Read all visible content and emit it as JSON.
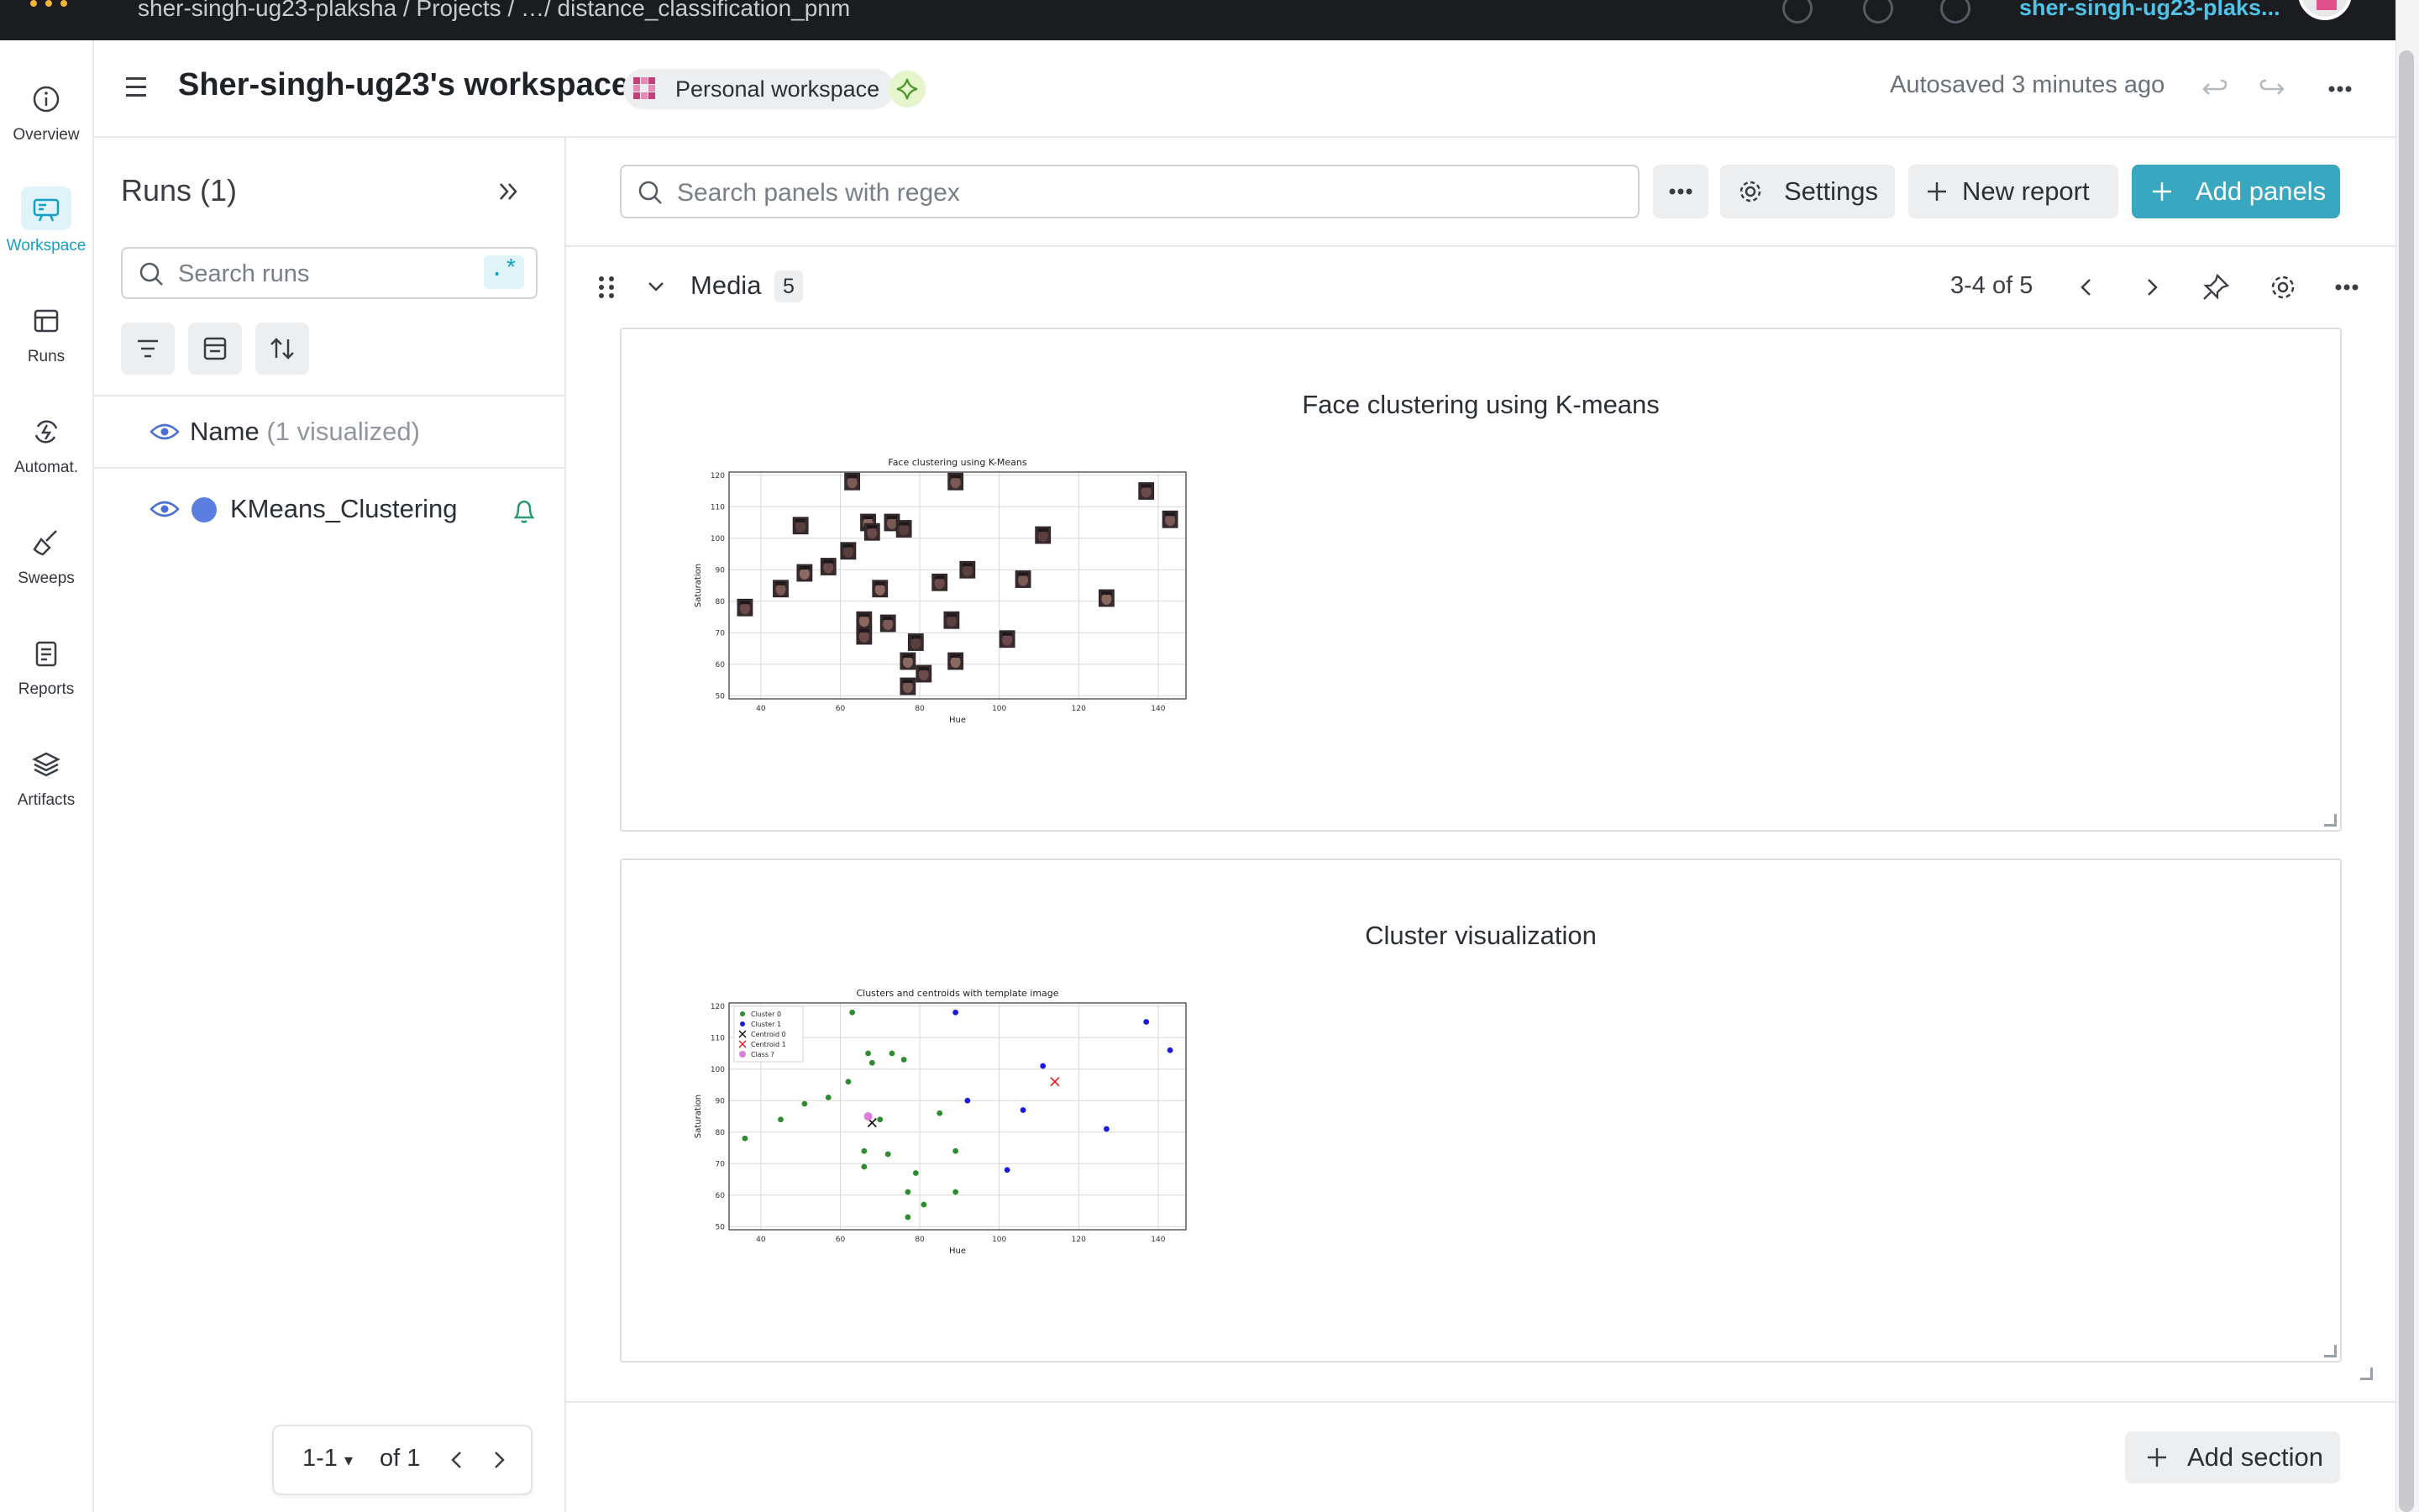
{
  "topbar": {
    "breadcrumb": "sher-singh-ug23-plaksha  /  Projects  /  …/ distance_classification_pnm",
    "username": "sher-singh-ug23-plaks..."
  },
  "nav": {
    "items": [
      {
        "label": "Overview",
        "icon": "info-icon"
      },
      {
        "label": "Workspace",
        "icon": "workspace-icon"
      },
      {
        "label": "Runs",
        "icon": "runs-table-icon"
      },
      {
        "label": "Automat.",
        "icon": "automation-icon"
      },
      {
        "label": "Sweeps",
        "icon": "broom-icon"
      },
      {
        "label": "Reports",
        "icon": "report-icon"
      },
      {
        "label": "Artifacts",
        "icon": "layers-icon"
      }
    ],
    "active": "Workspace",
    "accent": "#13a0c7"
  },
  "header": {
    "title": "Sher-singh-ug23's workspace",
    "badge": "Personal workspace",
    "autosaved": "Autosaved 3 minutes ago"
  },
  "runs": {
    "title": "Runs (1)",
    "search_placeholder": "Search runs",
    "regex_label": ".*",
    "name_header": "Name",
    "name_header_note": "(1 visualized)",
    "rows": [
      {
        "name": "KMeans_Clustering",
        "color": "#5b7fe0"
      }
    ],
    "pager": {
      "range": "1-1",
      "of": "of 1"
    }
  },
  "toolbar": {
    "search_placeholder": "Search panels with regex",
    "settings_label": "Settings",
    "new_report_label": "New report",
    "add_panels_label": "Add panels",
    "add_panels_color": "#3aa7c1"
  },
  "section": {
    "title": "Media",
    "count": "5",
    "pager": "3-4 of 5",
    "add_section_label": "Add section"
  },
  "panels": [
    {
      "title": "Face clustering using K-means",
      "plot_title": "Face clustering using K-Means",
      "xlabel": "Hue",
      "ylabel": "Saturation"
    },
    {
      "title": "Cluster visualization",
      "plot_title": "Clusters and centroids with template image",
      "xlabel": "Hue",
      "ylabel": "Saturation",
      "legend": [
        "Cluster 0",
        "Cluster 1",
        "Centroid 0",
        "Centroid 1",
        "Class ?"
      ]
    }
  ],
  "chart_data": [
    {
      "type": "scatter",
      "title": "Face clustering using K-Means",
      "xlabel": "Hue",
      "ylabel": "Saturation",
      "xlim": [
        32,
        147
      ],
      "ylim": [
        49,
        121
      ],
      "xticks": [
        40,
        60,
        80,
        100,
        120,
        140
      ],
      "yticks": [
        50,
        60,
        70,
        80,
        90,
        100,
        110,
        120
      ],
      "grid": true,
      "marker": "face-thumbnail",
      "points": [
        {
          "x": 36,
          "y": 78
        },
        {
          "x": 45,
          "y": 84
        },
        {
          "x": 50,
          "y": 104
        },
        {
          "x": 51,
          "y": 89
        },
        {
          "x": 57,
          "y": 91
        },
        {
          "x": 63,
          "y": 118
        },
        {
          "x": 62,
          "y": 96
        },
        {
          "x": 67,
          "y": 105
        },
        {
          "x": 68,
          "y": 102
        },
        {
          "x": 73,
          "y": 105
        },
        {
          "x": 76,
          "y": 103
        },
        {
          "x": 70,
          "y": 84
        },
        {
          "x": 85,
          "y": 86
        },
        {
          "x": 89,
          "y": 118
        },
        {
          "x": 92,
          "y": 90
        },
        {
          "x": 66,
          "y": 74
        },
        {
          "x": 66,
          "y": 69
        },
        {
          "x": 72,
          "y": 73
        },
        {
          "x": 79,
          "y": 67
        },
        {
          "x": 77,
          "y": 61
        },
        {
          "x": 81,
          "y": 57
        },
        {
          "x": 77,
          "y": 53
        },
        {
          "x": 88,
          "y": 74
        },
        {
          "x": 89,
          "y": 61
        },
        {
          "x": 102,
          "y": 68
        },
        {
          "x": 106,
          "y": 87
        },
        {
          "x": 111,
          "y": 101
        },
        {
          "x": 127,
          "y": 81
        },
        {
          "x": 137,
          "y": 115
        },
        {
          "x": 143,
          "y": 106
        }
      ]
    },
    {
      "type": "scatter",
      "title": "Clusters and centroids with template image",
      "xlabel": "Hue",
      "ylabel": "Saturation",
      "xlim": [
        32,
        147
      ],
      "ylim": [
        49,
        121
      ],
      "xticks": [
        40,
        60,
        80,
        100,
        120,
        140
      ],
      "yticks": [
        50,
        60,
        70,
        80,
        90,
        100,
        110,
        120
      ],
      "grid": true,
      "legend": "top-left",
      "series": [
        {
          "name": "Cluster 0",
          "color": "#2e8b2e",
          "marker": "dot",
          "points": [
            [
              36,
              78
            ],
            [
              45,
              84
            ],
            [
              50,
              104
            ],
            [
              51,
              89
            ],
            [
              57,
              91
            ],
            [
              63,
              118
            ],
            [
              62,
              96
            ],
            [
              67,
              105
            ],
            [
              68,
              102
            ],
            [
              73,
              105
            ],
            [
              76,
              103
            ],
            [
              70,
              84
            ],
            [
              85,
              86
            ],
            [
              89,
              74
            ],
            [
              89,
              61
            ],
            [
              66,
              74
            ],
            [
              66,
              69
            ],
            [
              72,
              73
            ],
            [
              79,
              67
            ],
            [
              77,
              61
            ],
            [
              81,
              57
            ],
            [
              77,
              53
            ]
          ]
        },
        {
          "name": "Cluster 1",
          "color": "#1a1adf",
          "marker": "dot",
          "points": [
            [
              89,
              118
            ],
            [
              92,
              90
            ],
            [
              102,
              68
            ],
            [
              106,
              87
            ],
            [
              111,
              101
            ],
            [
              127,
              81
            ],
            [
              137,
              115
            ],
            [
              143,
              106
            ]
          ]
        },
        {
          "name": "Centroid 0",
          "color": "#111111",
          "marker": "x",
          "points": [
            [
              68,
              83
            ]
          ]
        },
        {
          "name": "Centroid 1",
          "color": "#e02020",
          "marker": "x",
          "points": [
            [
              114,
              96
            ]
          ]
        },
        {
          "name": "Class ?",
          "color": "#e07ce0",
          "marker": "dot-large",
          "points": [
            [
              67,
              85
            ]
          ]
        }
      ]
    }
  ]
}
